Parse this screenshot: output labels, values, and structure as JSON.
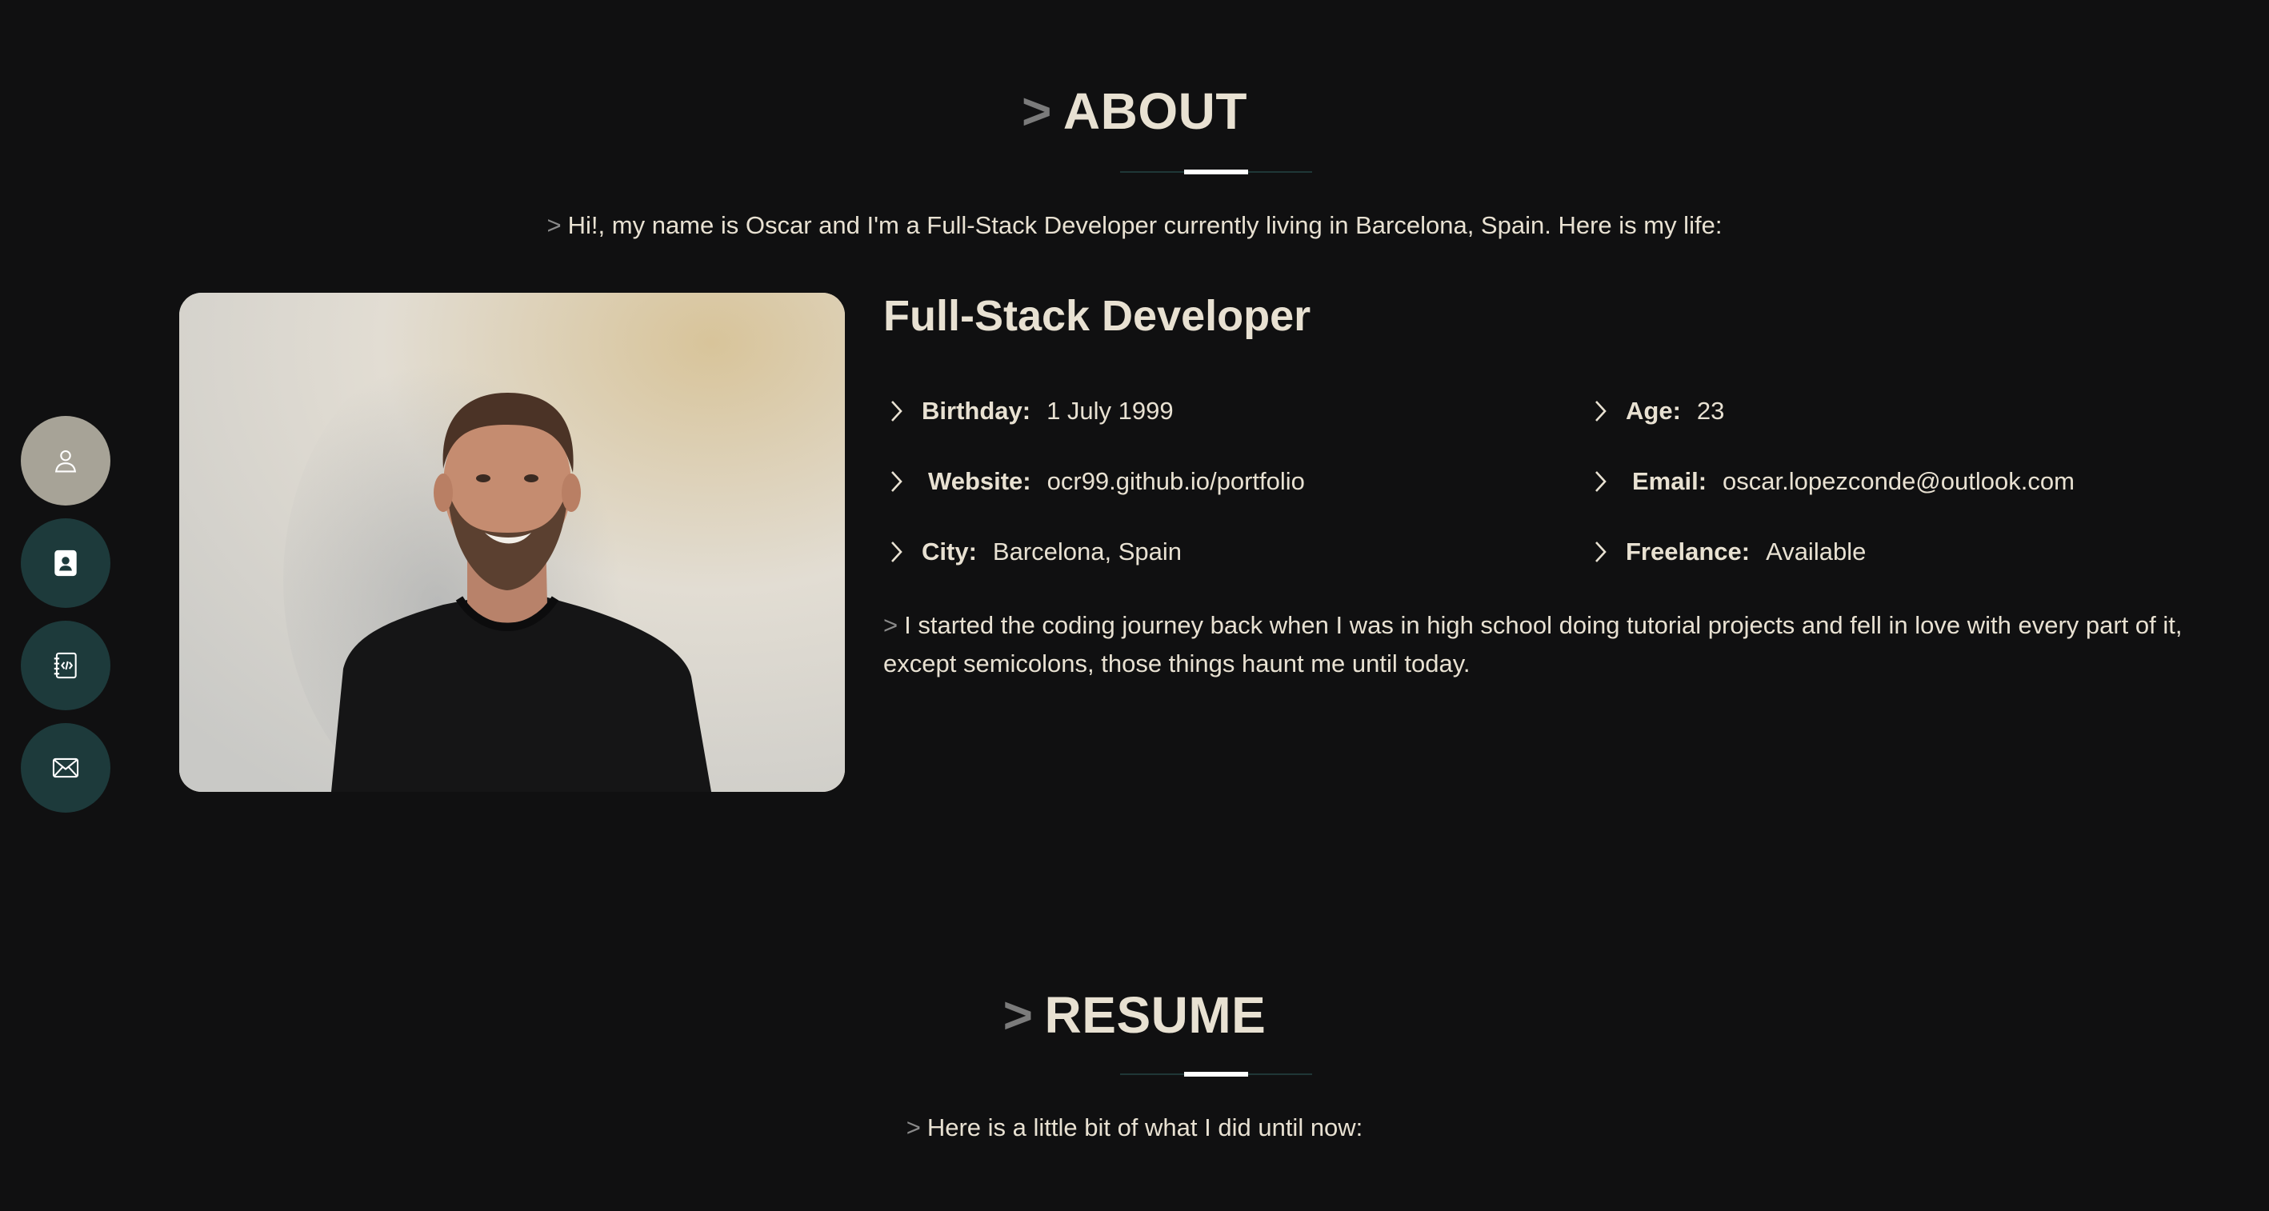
{
  "nav": {
    "items": [
      {
        "name": "about",
        "icon": "user-icon",
        "active": true
      },
      {
        "name": "resume",
        "icon": "contact-card-icon",
        "active": false
      },
      {
        "name": "portfolio",
        "icon": "code-notebook-icon",
        "active": false
      },
      {
        "name": "contact",
        "icon": "mail-icon",
        "active": false
      }
    ]
  },
  "about": {
    "caret": ">",
    "title": "ABOUT",
    "intro_caret": ">",
    "intro": "Hi!, my name is Oscar and I'm a Full-Stack Developer currently living in Barcelona, Spain. Here is my life:",
    "role": "Full-Stack Developer",
    "info": {
      "birthday": {
        "label": "Birthday:",
        "value": "1 July 1999"
      },
      "age": {
        "label": "Age:",
        "value": "23"
      },
      "website": {
        "label": "Website:",
        "value": "ocr99.github.io/portfolio"
      },
      "email": {
        "label": "Email:",
        "value": "oscar.lopezconde@outlook.com"
      },
      "city": {
        "label": "City:",
        "value": "Barcelona, Spain"
      },
      "freelance": {
        "label": "Freelance:",
        "value": "Available"
      }
    },
    "bio_caret": ">",
    "bio": "I started the coding journey back when I was in high school doing tutorial projects and fell in love with every part of it, except semicolons, those things haunt me until today."
  },
  "resume": {
    "caret": ">",
    "title": "RESUME",
    "intro_caret": ">",
    "intro": "Here is a little bit of what I did until now:"
  },
  "colors": {
    "background": "#101011",
    "text": "#e8e1d2",
    "nav_button": "#1d3a3b",
    "nav_button_active": "#a7a397",
    "caret": "#7b7b7b"
  }
}
